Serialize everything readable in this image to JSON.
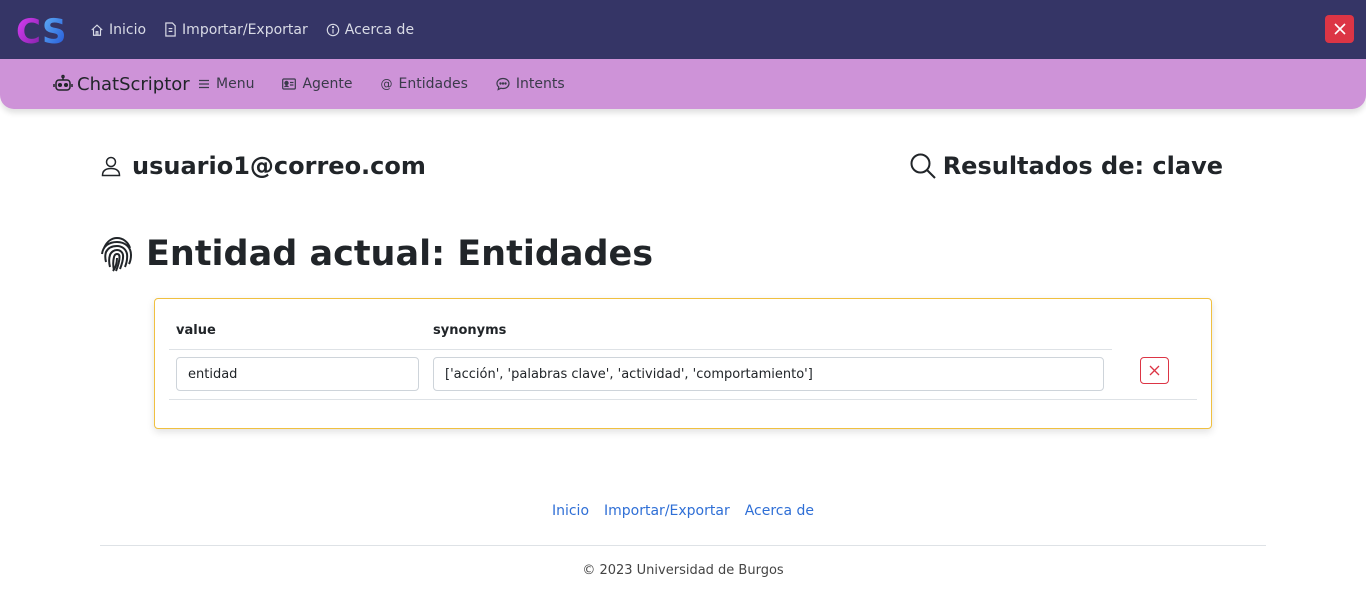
{
  "topbar": {
    "logo_text": "CS",
    "nav": [
      {
        "label": "Inicio",
        "icon": "home-icon"
      },
      {
        "label": "Importar/Exportar",
        "icon": "file-icon"
      },
      {
        "label": "Acerca de",
        "icon": "info-icon"
      }
    ],
    "close_icon": "close-icon",
    "colors": {
      "bar": "#353566",
      "close": "#dc3545"
    }
  },
  "subbar": {
    "brand": "ChatScriptor",
    "brand_icon": "robot-icon",
    "nav": [
      {
        "label": "Menu",
        "icon": "list-icon"
      },
      {
        "label": "Agente",
        "icon": "id-card-icon"
      },
      {
        "label": "Entidades",
        "icon": "at-icon"
      },
      {
        "label": "Intents",
        "icon": "chat-icon"
      }
    ],
    "colors": {
      "bar": "#ce93d8"
    }
  },
  "user": {
    "email": "usuario1@correo.com",
    "icon": "person-icon"
  },
  "search": {
    "label": "Resultados de: clave",
    "icon": "search-icon"
  },
  "entity": {
    "title": "Entidad actual: Entidades",
    "icon": "fingerprint-icon"
  },
  "table": {
    "headers": {
      "value": "value",
      "synonyms": "synonyms"
    },
    "rows": [
      {
        "value": "entidad",
        "synonyms": "['acción', 'palabras clave', 'actividad', 'comportamiento']"
      }
    ],
    "colors": {
      "card_border": "#f0c040",
      "delete": "#dc3545"
    }
  },
  "footer": {
    "links": [
      "Inicio",
      "Importar/Exportar",
      "Acerca de"
    ],
    "copyright": "© 2023 Universidad de Burgos"
  }
}
